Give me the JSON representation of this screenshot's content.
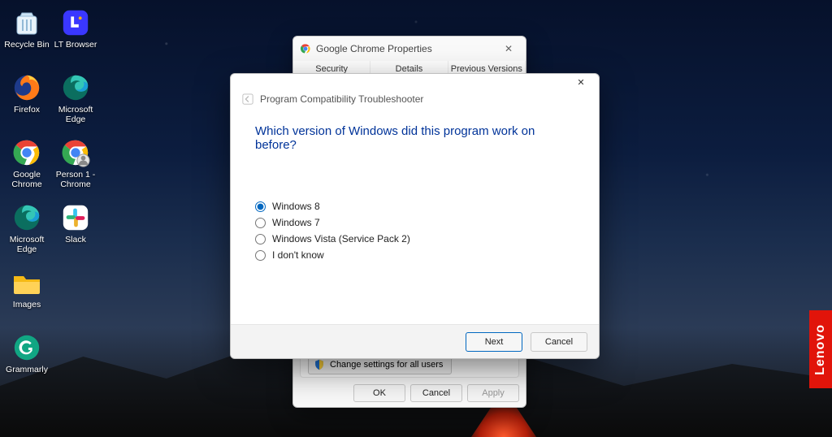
{
  "desktop": {
    "icons": [
      {
        "name": "recycle-bin",
        "label": "Recycle Bin"
      },
      {
        "name": "firefox",
        "label": "Firefox"
      },
      {
        "name": "google-chrome",
        "label": "Google Chrome"
      },
      {
        "name": "microsoft-edge-2",
        "label": "Microsoft Edge"
      },
      {
        "name": "images-folder",
        "label": "Images"
      },
      {
        "name": "grammarly",
        "label": "Grammarly"
      },
      {
        "name": "lt-browser",
        "label": "LT Browser"
      },
      {
        "name": "microsoft-edge",
        "label": "Microsoft Edge"
      },
      {
        "name": "person1-chrome",
        "label": "Person 1 - Chrome"
      },
      {
        "name": "slack",
        "label": "Slack"
      }
    ]
  },
  "lenovo_badge": "Lenovo",
  "properties_window": {
    "title": "Google Chrome Properties",
    "tabs": [
      "Security",
      "Details",
      "Previous Versions"
    ],
    "change_settings_label": "Change settings for all users",
    "buttons": {
      "ok": "OK",
      "cancel": "Cancel",
      "apply": "Apply"
    }
  },
  "troubleshooter": {
    "breadcrumb": "Program Compatibility Troubleshooter",
    "heading": "Which version of Windows did this program work on before?",
    "options": [
      {
        "label": "Windows 8",
        "selected": true
      },
      {
        "label": "Windows 7",
        "selected": false
      },
      {
        "label": "Windows Vista (Service Pack 2)",
        "selected": false
      },
      {
        "label": "I don't know",
        "selected": false
      }
    ],
    "buttons": {
      "next": "Next",
      "cancel": "Cancel"
    }
  }
}
